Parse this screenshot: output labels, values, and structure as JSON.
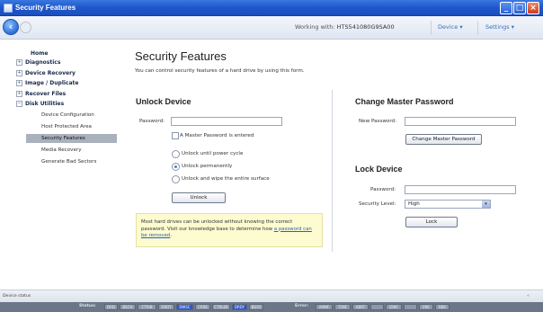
{
  "window": {
    "title": "Security Features"
  },
  "toolbar": {
    "working_label": "Working with:",
    "drive_name": "HTS541080G9SA00",
    "device_menu": "Device",
    "settings_menu": "Settings"
  },
  "sidebar": {
    "home": "Home",
    "groups": [
      {
        "label": "Diagnostics",
        "expander": "+"
      },
      {
        "label": "Device Recovery",
        "expander": "+"
      },
      {
        "label": "Image / Duplicate",
        "expander": "+"
      },
      {
        "label": "Recover Files",
        "expander": "+"
      },
      {
        "label": "Disk Utilities",
        "expander": "−"
      }
    ],
    "sub_items": [
      {
        "label": "Device Configuration"
      },
      {
        "label": "Host Protected Area"
      },
      {
        "label": "Security Features"
      },
      {
        "label": "Media Recovery"
      },
      {
        "label": "Generate Bad Sectors"
      }
    ]
  },
  "main": {
    "title": "Security Features",
    "subtitle": "You can control security features of a hard drive by using this form."
  },
  "unlock": {
    "heading": "Unlock Device",
    "password_label": "Password:",
    "password_value": "",
    "master_checkbox_label": "A Master Password is entered",
    "master_checked": false,
    "options": [
      {
        "label": "Unlock until power cycle",
        "checked": false
      },
      {
        "label": "Unlock permanently",
        "checked": true
      },
      {
        "label": "Unlock and wipe the entire surface",
        "checked": false
      }
    ],
    "button": "Unlock"
  },
  "note": {
    "text": "Most hard drives can be unlocked without knowing the correct password. Visit our knowledge base to determine how",
    "link": "a password can be removed",
    "end": "."
  },
  "change_master": {
    "heading": "Change Master Password",
    "new_password_label": "New Password:",
    "new_password_value": "",
    "button": "Change Master Password"
  },
  "lock": {
    "heading": "Lock Device",
    "password_label": "Password:",
    "password_value": "",
    "security_level_label": "Security Level:",
    "security_level_value": "High",
    "button": "Lock"
  },
  "statusbar": {
    "device_status": "Device status",
    "status_caption": "Status:",
    "status_regs": [
      {
        "label": "DRD",
        "on": false
      },
      {
        "label": "BSCH",
        "on": false
      },
      {
        "label": "CTRIB",
        "on": false
      },
      {
        "label": "DRDY",
        "on": false
      },
      {
        "label": "DWSC",
        "on": true
      },
      {
        "label": "CRRE",
        "on": false
      },
      {
        "label": "CTRLER",
        "on": false
      },
      {
        "label": "DRDY",
        "on": true
      },
      {
        "label": "BUSY",
        "on": false
      }
    ],
    "error_caption": "Error:",
    "error_regs": [
      {
        "label": "AMNF",
        "on": false
      },
      {
        "label": "T0NF",
        "on": false
      },
      {
        "label": "ABRT",
        "on": false
      },
      {
        "label": "",
        "on": false
      },
      {
        "label": "IDNF",
        "on": false
      },
      {
        "label": "",
        "on": false
      },
      {
        "label": "UNC",
        "on": false
      },
      {
        "label": "BBK",
        "on": false
      }
    ]
  },
  "colors": {
    "titlebar": "#1f56c9",
    "accent": "#3a6fc0",
    "active_item": "#a9b1bc",
    "note_bg": "#fdfbd0"
  }
}
